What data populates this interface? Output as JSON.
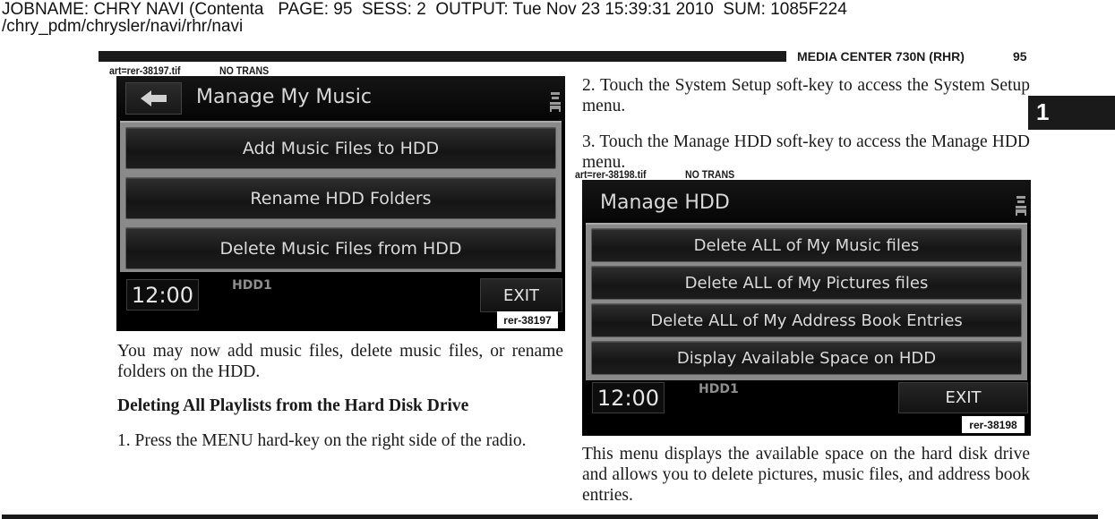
{
  "job_header": {
    "line1": "JOBNAME: CHRY NAVI (Contenta   PAGE: 95  SESS: 2  OUTPUT: Tue Nov 23 15:39:31 2010  SUM: 1085F224",
    "line2": "/chry_pdm/chrysler/navi/rhr/navi"
  },
  "running_head": {
    "section": "MEDIA CENTER 730N (RHR)",
    "page_number": "95"
  },
  "chapter_tab": "1",
  "figure1": {
    "art_label": "art=rer-38197.tif",
    "trans_label": "NO TRANS",
    "screen": {
      "title": "Manage My Music",
      "back_icon": "back-arrow-icon",
      "seat_icon": "seat-icon",
      "buttons": [
        "Add Music Files to HDD",
        "Rename HDD Folders",
        "Delete Music Files from HDD"
      ],
      "clock": "12:00",
      "source": "HDD1",
      "exit": "EXIT"
    },
    "ref": "rer-38197"
  },
  "left_column": {
    "para1": "You may now add music files, delete music files, or rename folders on the HDD.",
    "heading": "Deleting All Playlists from the Hard Disk Drive",
    "step1": "1. Press the MENU hard-key on the right side of the radio."
  },
  "right_column": {
    "step2": "2.  Touch the System Setup soft-key to access the System Setup menu.",
    "step3": "3.  Touch the Manage HDD soft-key to access the Manage HDD menu.",
    "para_after": "This menu displays the available space on the hard disk drive and allows you to delete pictures, music files, and address book entries."
  },
  "figure2": {
    "art_label": "art=rer-38198.tif",
    "trans_label": "NO TRANS",
    "screen": {
      "title": "Manage HDD",
      "seat_icon": "seat-icon",
      "buttons": [
        "Delete ALL of My Music files",
        "Delete ALL of My Pictures files",
        "Delete ALL of My Address Book Entries",
        "Display Available Space on HDD"
      ],
      "clock": "12:00",
      "source": "HDD1",
      "exit": "EXIT"
    },
    "ref": "rer-38198"
  }
}
